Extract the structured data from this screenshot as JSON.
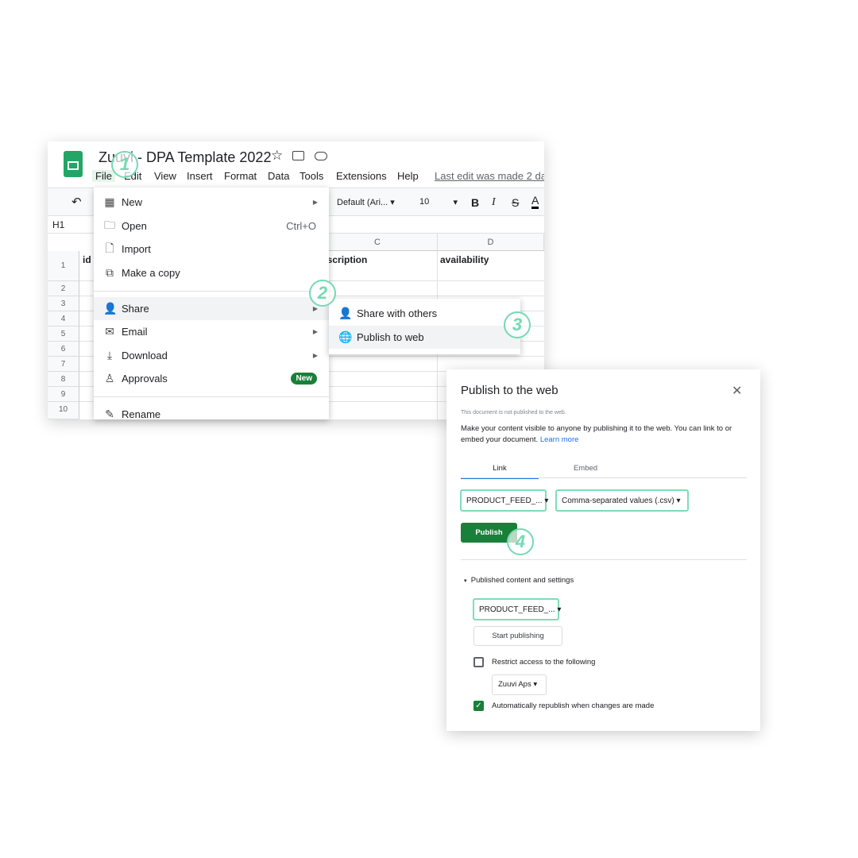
{
  "sheets": {
    "title": "Zuuvi - DPA Template 2022",
    "menus": [
      "File",
      "Edit",
      "View",
      "Insert",
      "Format",
      "Data",
      "Tools",
      "Extensions",
      "Help"
    ],
    "last_edit": "Last edit was made 2 da",
    "toolbar": {
      "font": "Default (Ari...",
      "size": "10"
    },
    "cell_ref": "H1",
    "columns": [
      "C",
      "D"
    ],
    "cells": {
      "a1": "id",
      "c1": "escription",
      "d1": "availability"
    },
    "rows": [
      "1",
      "2",
      "3",
      "4",
      "5",
      "6",
      "7",
      "8",
      "9",
      "10"
    ]
  },
  "file_menu": {
    "items": [
      {
        "label": "New",
        "icon": "new-icon"
      },
      {
        "label": "Open",
        "shortcut": "Ctrl+O",
        "icon": "folder-icon"
      },
      {
        "label": "Import",
        "icon": "file-icon"
      },
      {
        "label": "Make a copy",
        "icon": "copy-icon"
      },
      {
        "label": "Share",
        "icon": "person-add-icon"
      },
      {
        "label": "Email",
        "icon": "mail-icon"
      },
      {
        "label": "Download",
        "icon": "download-icon"
      },
      {
        "label": "Approvals",
        "badge": "New",
        "icon": "approvals-icon"
      },
      {
        "label": "Rename",
        "icon": "rename-icon"
      }
    ]
  },
  "share_menu": {
    "items": [
      "Share with others",
      "Publish to web"
    ]
  },
  "dialog": {
    "title": "Publish to the web",
    "status": "This document is not published to the web.",
    "description": "Make your content visible to anyone by publishing it to the web. You can link to or embed your document.",
    "learn_more": "Learn more",
    "tabs": [
      "Link",
      "Embed"
    ],
    "sheet_select": "PRODUCT_FEED_...",
    "format_select": "Comma-separated values (.csv)",
    "publish": "Publish",
    "section": "Published content and settings",
    "sheet_select2": "PRODUCT_FEED_...",
    "start_publishing": "Start publishing",
    "restrict": "Restrict access to the following",
    "restrict_checked": false,
    "org_select": "Zuuvi Aps",
    "auto_republish": "Automatically republish when changes are made",
    "auto_checked": true
  },
  "steps": [
    "1",
    "2",
    "3",
    "4"
  ],
  "colors": {
    "accent": "#188038",
    "step": "#74d9b4",
    "link": "#1a73e8"
  }
}
